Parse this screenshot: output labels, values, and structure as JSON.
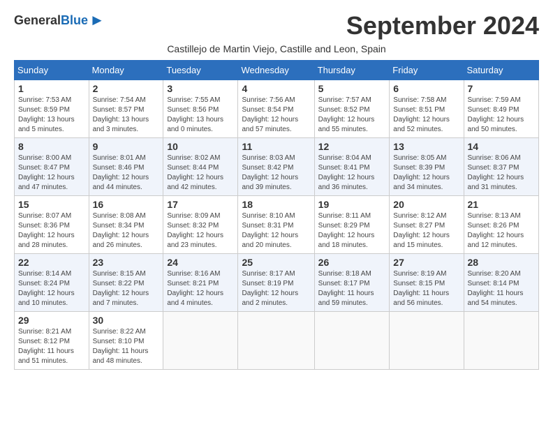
{
  "header": {
    "logo_general": "General",
    "logo_blue": "Blue",
    "month_title": "September 2024",
    "subtitle": "Castillejo de Martin Viejo, Castille and Leon, Spain"
  },
  "weekdays": [
    "Sunday",
    "Monday",
    "Tuesday",
    "Wednesday",
    "Thursday",
    "Friday",
    "Saturday"
  ],
  "weeks": [
    [
      {
        "day": "1",
        "sunrise": "7:53 AM",
        "sunset": "8:59 PM",
        "daylight": "13 hours and 5 minutes."
      },
      {
        "day": "2",
        "sunrise": "7:54 AM",
        "sunset": "8:57 PM",
        "daylight": "13 hours and 3 minutes."
      },
      {
        "day": "3",
        "sunrise": "7:55 AM",
        "sunset": "8:56 PM",
        "daylight": "13 hours and 0 minutes."
      },
      {
        "day": "4",
        "sunrise": "7:56 AM",
        "sunset": "8:54 PM",
        "daylight": "12 hours and 57 minutes."
      },
      {
        "day": "5",
        "sunrise": "7:57 AM",
        "sunset": "8:52 PM",
        "daylight": "12 hours and 55 minutes."
      },
      {
        "day": "6",
        "sunrise": "7:58 AM",
        "sunset": "8:51 PM",
        "daylight": "12 hours and 52 minutes."
      },
      {
        "day": "7",
        "sunrise": "7:59 AM",
        "sunset": "8:49 PM",
        "daylight": "12 hours and 50 minutes."
      }
    ],
    [
      {
        "day": "8",
        "sunrise": "8:00 AM",
        "sunset": "8:47 PM",
        "daylight": "12 hours and 47 minutes."
      },
      {
        "day": "9",
        "sunrise": "8:01 AM",
        "sunset": "8:46 PM",
        "daylight": "12 hours and 44 minutes."
      },
      {
        "day": "10",
        "sunrise": "8:02 AM",
        "sunset": "8:44 PM",
        "daylight": "12 hours and 42 minutes."
      },
      {
        "day": "11",
        "sunrise": "8:03 AM",
        "sunset": "8:42 PM",
        "daylight": "12 hours and 39 minutes."
      },
      {
        "day": "12",
        "sunrise": "8:04 AM",
        "sunset": "8:41 PM",
        "daylight": "12 hours and 36 minutes."
      },
      {
        "day": "13",
        "sunrise": "8:05 AM",
        "sunset": "8:39 PM",
        "daylight": "12 hours and 34 minutes."
      },
      {
        "day": "14",
        "sunrise": "8:06 AM",
        "sunset": "8:37 PM",
        "daylight": "12 hours and 31 minutes."
      }
    ],
    [
      {
        "day": "15",
        "sunrise": "8:07 AM",
        "sunset": "8:36 PM",
        "daylight": "12 hours and 28 minutes."
      },
      {
        "day": "16",
        "sunrise": "8:08 AM",
        "sunset": "8:34 PM",
        "daylight": "12 hours and 26 minutes."
      },
      {
        "day": "17",
        "sunrise": "8:09 AM",
        "sunset": "8:32 PM",
        "daylight": "12 hours and 23 minutes."
      },
      {
        "day": "18",
        "sunrise": "8:10 AM",
        "sunset": "8:31 PM",
        "daylight": "12 hours and 20 minutes."
      },
      {
        "day": "19",
        "sunrise": "8:11 AM",
        "sunset": "8:29 PM",
        "daylight": "12 hours and 18 minutes."
      },
      {
        "day": "20",
        "sunrise": "8:12 AM",
        "sunset": "8:27 PM",
        "daylight": "12 hours and 15 minutes."
      },
      {
        "day": "21",
        "sunrise": "8:13 AM",
        "sunset": "8:26 PM",
        "daylight": "12 hours and 12 minutes."
      }
    ],
    [
      {
        "day": "22",
        "sunrise": "8:14 AM",
        "sunset": "8:24 PM",
        "daylight": "12 hours and 10 minutes."
      },
      {
        "day": "23",
        "sunrise": "8:15 AM",
        "sunset": "8:22 PM",
        "daylight": "12 hours and 7 minutes."
      },
      {
        "day": "24",
        "sunrise": "8:16 AM",
        "sunset": "8:21 PM",
        "daylight": "12 hours and 4 minutes."
      },
      {
        "day": "25",
        "sunrise": "8:17 AM",
        "sunset": "8:19 PM",
        "daylight": "12 hours and 2 minutes."
      },
      {
        "day": "26",
        "sunrise": "8:18 AM",
        "sunset": "8:17 PM",
        "daylight": "11 hours and 59 minutes."
      },
      {
        "day": "27",
        "sunrise": "8:19 AM",
        "sunset": "8:15 PM",
        "daylight": "11 hours and 56 minutes."
      },
      {
        "day": "28",
        "sunrise": "8:20 AM",
        "sunset": "8:14 PM",
        "daylight": "11 hours and 54 minutes."
      }
    ],
    [
      {
        "day": "29",
        "sunrise": "8:21 AM",
        "sunset": "8:12 PM",
        "daylight": "11 hours and 51 minutes."
      },
      {
        "day": "30",
        "sunrise": "8:22 AM",
        "sunset": "8:10 PM",
        "daylight": "11 hours and 48 minutes."
      },
      null,
      null,
      null,
      null,
      null
    ]
  ],
  "labels": {
    "sunrise": "Sunrise: ",
    "sunset": "Sunset: ",
    "daylight": "Daylight: "
  }
}
